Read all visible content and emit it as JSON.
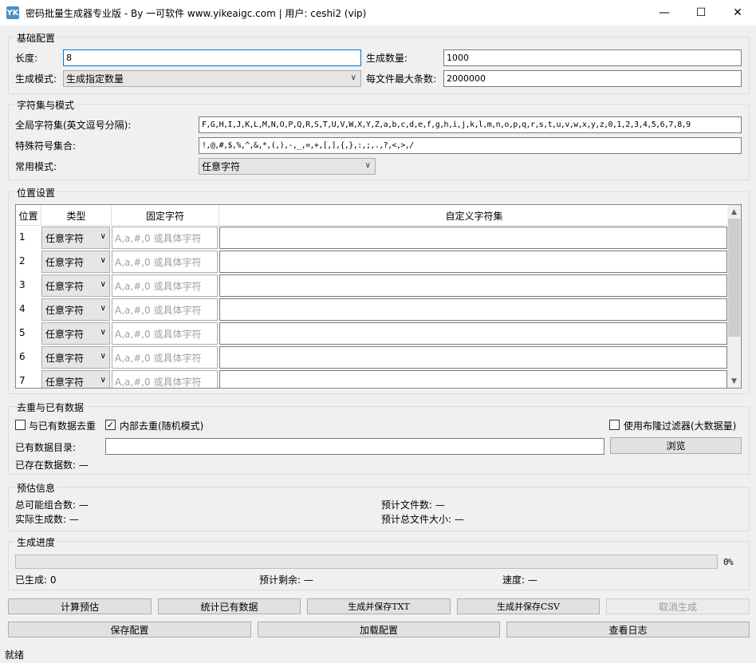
{
  "window": {
    "title": "密码批量生成器专业版 - By 一可软件 www.yikeaigc.com  |  用户: ceshi2 (vip)",
    "app_icon_text": "YK",
    "minimize": "—",
    "maximize": "☐",
    "close": "✕"
  },
  "basic": {
    "section_title": "基础配置",
    "length_label": "长度:",
    "length_value": "8",
    "count_label": "生成数量:",
    "count_value": "1000",
    "mode_label": "生成模式:",
    "mode_value": "生成指定数量",
    "maxper_label": "每文件最大条数:",
    "maxper_value": "2000000"
  },
  "charset": {
    "section_title": "字符集与模式",
    "global_label": "全局字符集(英文逗号分隔):",
    "global_value": "F,G,H,I,J,K,L,M,N,O,P,Q,R,S,T,U,V,W,X,Y,Z,a,b,c,d,e,f,g,h,i,j,k,l,m,n,o,p,q,r,s,t,u,v,w,x,y,z,0,1,2,3,4,5,6,7,8,9",
    "special_label": "特殊符号集合:",
    "special_value": "!,@,#,$,%,^,&,*,(,),-,_,=,+,[,],{,},:,;,.,?,<,>,/",
    "common_label": "常用模式:",
    "common_value": "任意字符"
  },
  "position": {
    "section_title": "位置设置",
    "columns": [
      "位置",
      "类型",
      "固定字符",
      "自定义字符集"
    ],
    "fixed_placeholder": "A,a,#,0 或具体字符",
    "rows": [
      {
        "pos": "1",
        "type": "任意字符"
      },
      {
        "pos": "2",
        "type": "任意字符"
      },
      {
        "pos": "3",
        "type": "任意字符"
      },
      {
        "pos": "4",
        "type": "任意字符"
      },
      {
        "pos": "5",
        "type": "任意字符"
      },
      {
        "pos": "6",
        "type": "任意字符"
      },
      {
        "pos": "7",
        "type": "任意字符"
      }
    ]
  },
  "dedup": {
    "section_title": "去重与已有数据",
    "existing_dedup_label": "与已有数据去重",
    "existing_dedup_checked": false,
    "internal_dedup_label": "内部去重(随机模式)",
    "internal_dedup_checked": true,
    "bloom_label": "使用布隆过滤器(大数据量)",
    "bloom_checked": false,
    "dir_label": "已有数据目录:",
    "dir_value": "",
    "browse_label": "浏览",
    "existing_count_label": "已存在数据数: —"
  },
  "estimate": {
    "section_title": "预估信息",
    "total_combos": "总可能组合数: —",
    "files_count": "预计文件数: —",
    "actual_count": "实际生成数: —",
    "total_size": "预计总文件大小: —"
  },
  "progress": {
    "section_title": "生成进度",
    "percent_text": "0%",
    "percent": 0,
    "generated": "已生成: 0",
    "remaining": "预计剩余: —",
    "speed": "速度: —"
  },
  "buttons": {
    "calc": "计算预估",
    "stats": "统计已有数据",
    "save_txt": "生成并保存TXT",
    "save_csv": "生成并保存CSV",
    "cancel": "取消生成",
    "save_config": "保存配置",
    "load_config": "加载配置",
    "view_log": "查看日志"
  },
  "status": {
    "text": "就绪"
  }
}
